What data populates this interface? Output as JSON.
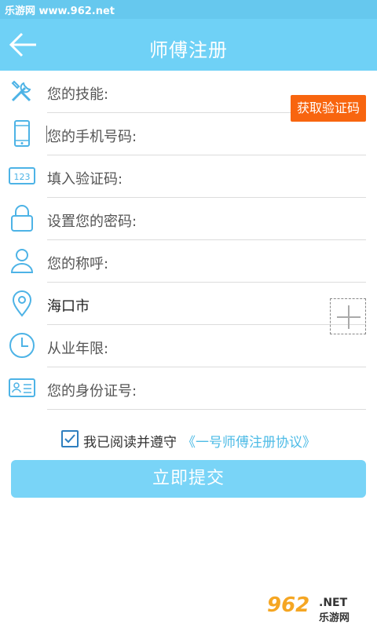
{
  "status_bar": {
    "watermark": "乐游网 www.962.net"
  },
  "app_bar": {
    "title": "师傅注册",
    "back_icon": "arrow-left-icon"
  },
  "form": {
    "skills": {
      "label": "您的技能:",
      "icon": "tools-icon"
    },
    "phone": {
      "label": "您的手机号码:",
      "icon": "phone-icon"
    },
    "verify_code": {
      "label": "填入验证码:",
      "icon": "code-123-icon",
      "button": "获取验证码"
    },
    "password": {
      "label": "设置您的密码:",
      "icon": "lock-icon"
    },
    "nickname": {
      "label": "您的称呼:",
      "icon": "user-icon"
    },
    "location": {
      "value": "海口市",
      "icon": "location-pin-icon"
    },
    "years": {
      "label": "从业年限:",
      "icon": "clock-icon"
    },
    "id_number": {
      "label": "您的身份证号:",
      "icon": "id-card-icon",
      "add_icon": "plus-icon"
    }
  },
  "agreement": {
    "checked": true,
    "text": "我已阅读并遵守",
    "link": "《一号师傅注册协议》"
  },
  "submit_label": "立即提交",
  "watermark": {
    "logo": "962",
    "net": ".NET",
    "sub": "乐游网"
  },
  "colors": {
    "accent": "#6fd1f6",
    "code_button": "#f8650f",
    "link": "#4dbbe6",
    "icon": "#4db3e6"
  }
}
